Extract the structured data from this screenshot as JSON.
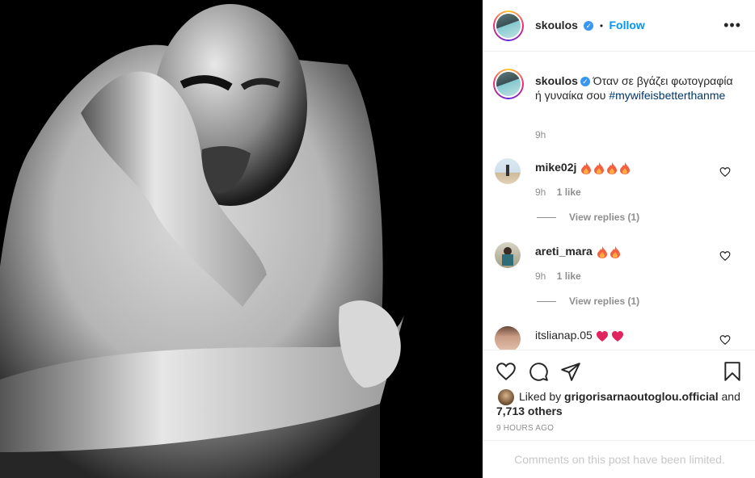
{
  "post": {
    "username": "skoulos",
    "follow_label": "Follow",
    "dot": "•",
    "more": "•••"
  },
  "caption": {
    "username": "skoulos",
    "text": "Όταν σε βγάζει φωτογραφία ή γυναίκα σου",
    "hashtag": "#mywifeisbetterthanme",
    "time": "9h"
  },
  "comments": [
    {
      "username": "mike02j",
      "emoji_count": 4,
      "emoji": "fire-icon",
      "time": "9h",
      "likes": "1 like",
      "view_replies": "View replies (1)"
    },
    {
      "username": "areti_mara",
      "emoji_count": 2,
      "emoji": "fire-icon",
      "time": "9h",
      "likes": "1 like",
      "view_replies": "View replies (1)"
    },
    {
      "username": "itslianap.05",
      "emoji_count": 2,
      "emoji": "red-heart-icon"
    }
  ],
  "likes": {
    "prefix": "Liked by",
    "user": "grigorisarnaoutoglou.official",
    "and": "and",
    "others": "7,713 others"
  },
  "time_ago": "9 HOURS AGO",
  "comments_limited": "Comments on this post have been limited.",
  "colors": {
    "accent": "#0095f6",
    "hashtag": "#00376b",
    "muted": "#8e8e8e",
    "heart": "#ed4956",
    "fire": "#f56040"
  }
}
